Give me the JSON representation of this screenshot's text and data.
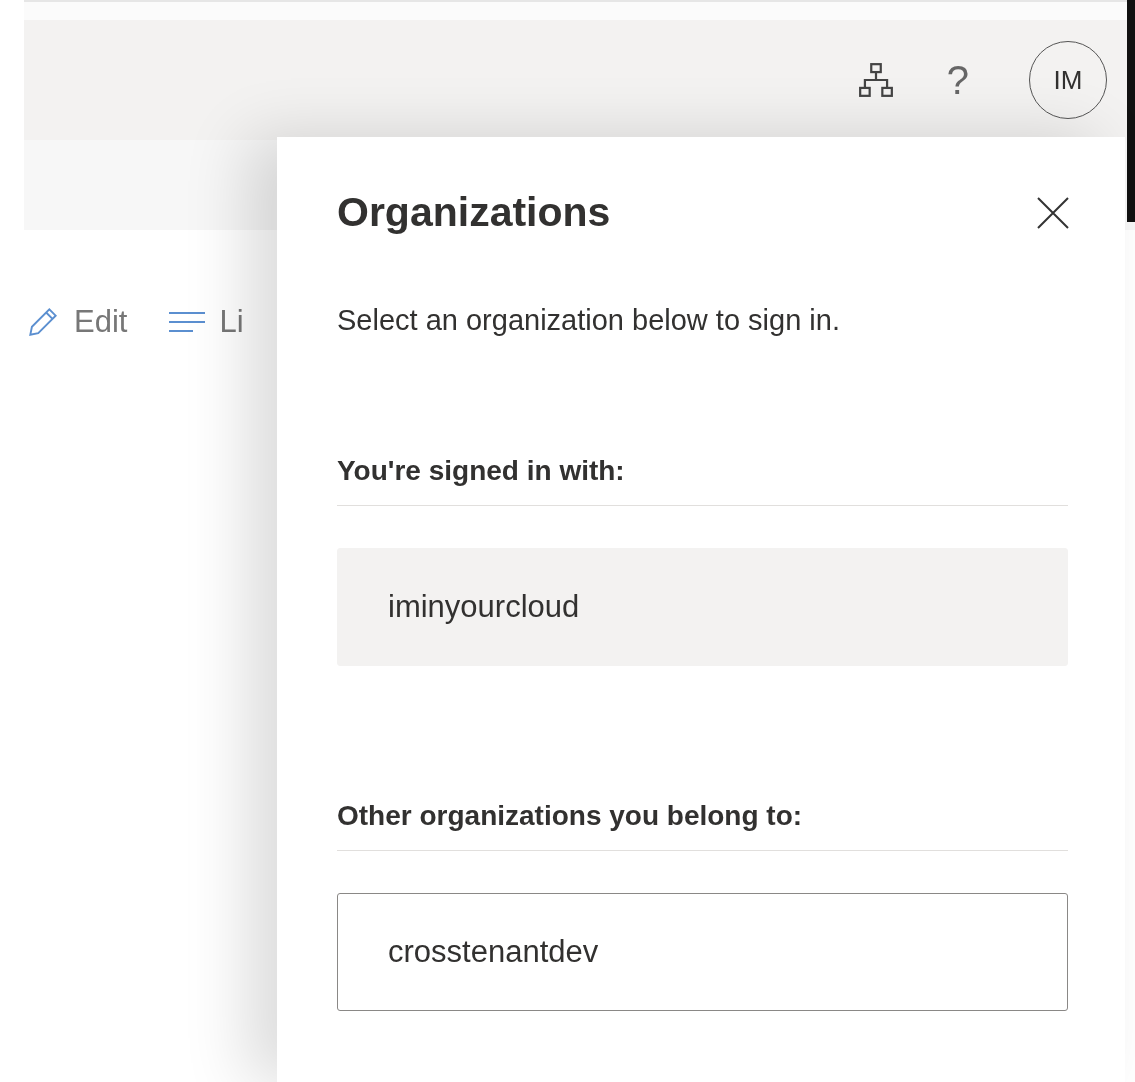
{
  "header": {
    "avatar": "IM",
    "help": "?"
  },
  "toolbar": [
    {
      "label": "Edit",
      "kind": "edit"
    },
    {
      "label": "Li",
      "kind": "list"
    }
  ],
  "panel": {
    "title": "Organizations",
    "description": "Select an organization below to sign in.",
    "sections": [
      {
        "heading": "You're signed in with:",
        "organizations": [
          {
            "name": "iminyourcloud",
            "selected": true
          }
        ]
      },
      {
        "heading": "Other organizations you belong to:",
        "organizations": [
          {
            "name": "crosstenantdev",
            "selected": false
          }
        ]
      }
    ]
  }
}
